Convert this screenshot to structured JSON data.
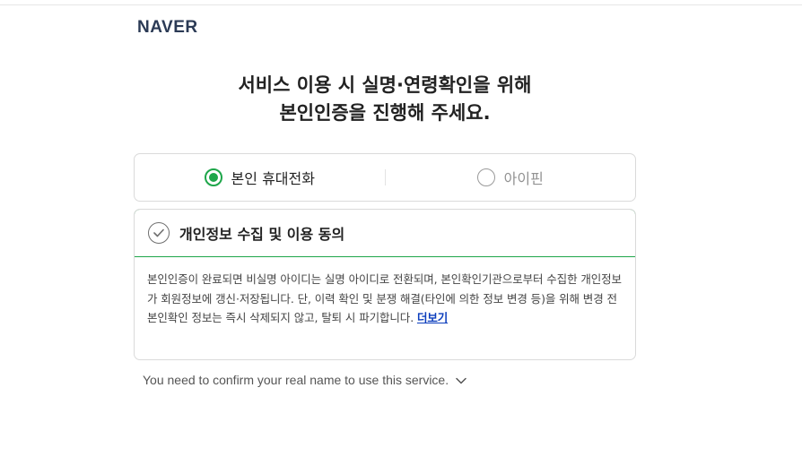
{
  "brand": {
    "logo_text": "NAVER"
  },
  "headline": {
    "line1": "서비스 이용 시 실명·연령확인을 위해",
    "line2": "본인인증을 진행해 주세요."
  },
  "methods": {
    "phone": {
      "label": "본인 휴대전화",
      "selected": true
    },
    "ipin": {
      "label": "아이핀",
      "selected": false
    }
  },
  "consent": {
    "title": "개인정보 수집 및 이용 동의",
    "body": "본인인증이 완료되면 비실명 아이디는 실명 아이디로 전환되며, 본인확인기관으로부터 수집한 개인정보가 회원정보에 갱신·저장됩니다. 단, 이력 확인 및 분쟁 해결(타인에 의한 정보 변경 등)을 위해 변경 전 본인확인 정보는 즉시 삭제되지 않고, 탈퇴 시 파기합니다. ",
    "more_link": "더보기"
  },
  "english_notice": {
    "text": "You need to confirm your real name to use this service."
  },
  "colors": {
    "accent_green": "#1ea64a",
    "link_blue": "#0b3dbd",
    "logo_navy": "#2b3a55"
  },
  "icons": {
    "radio_selected": "radio-selected-icon",
    "radio_unselected": "radio-unselected-icon",
    "check": "check-circle-icon",
    "chevron": "chevron-down-icon"
  }
}
